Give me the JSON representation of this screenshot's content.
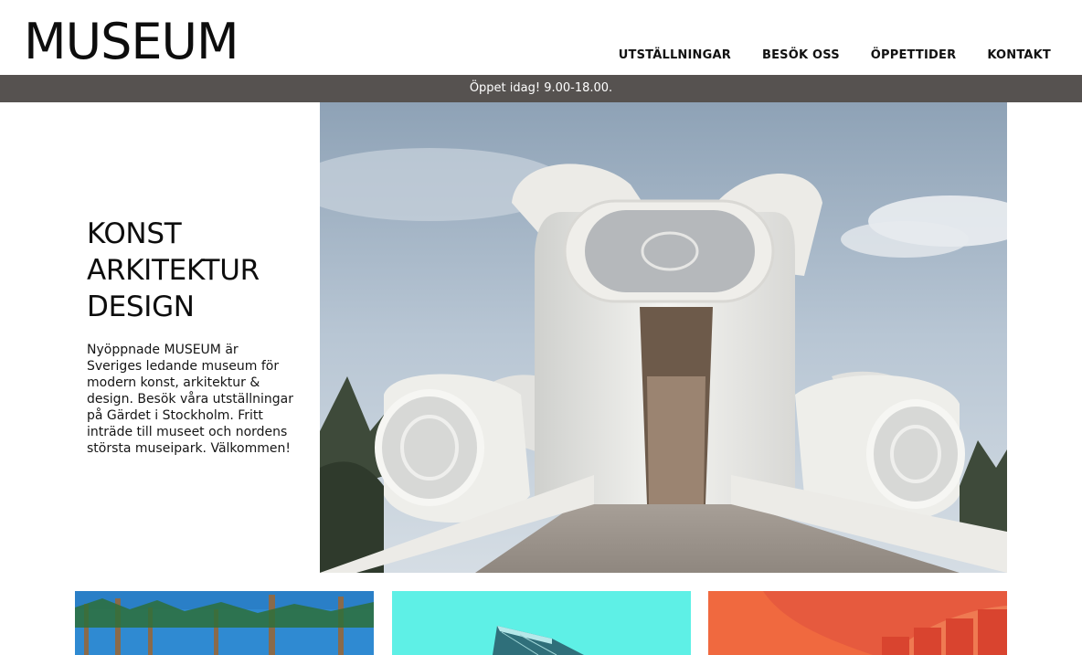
{
  "header": {
    "logo": "MUSEUM",
    "nav": [
      {
        "label": "UTSTÄLLNINGAR"
      },
      {
        "label": "BESÖK OSS"
      },
      {
        "label": "ÖPPETTIDER"
      },
      {
        "label": "KONTAKT"
      }
    ]
  },
  "banner": {
    "text": "Öppet idag! 9.00-18.00."
  },
  "intro": {
    "heading_lines": [
      "KONST",
      "ARKITEKTUR",
      "DESIGN"
    ],
    "text": "Nyöppnade MUSEUM är Sveriges ledande museum för modern konst, arkitektur & design. Besök våra utställningar på Gärdet i Stockholm. Fritt inträde till museet och nordens största museipark. Välkommen!"
  },
  "colors": {
    "banner_bg": "#565250",
    "text": "#111111"
  }
}
